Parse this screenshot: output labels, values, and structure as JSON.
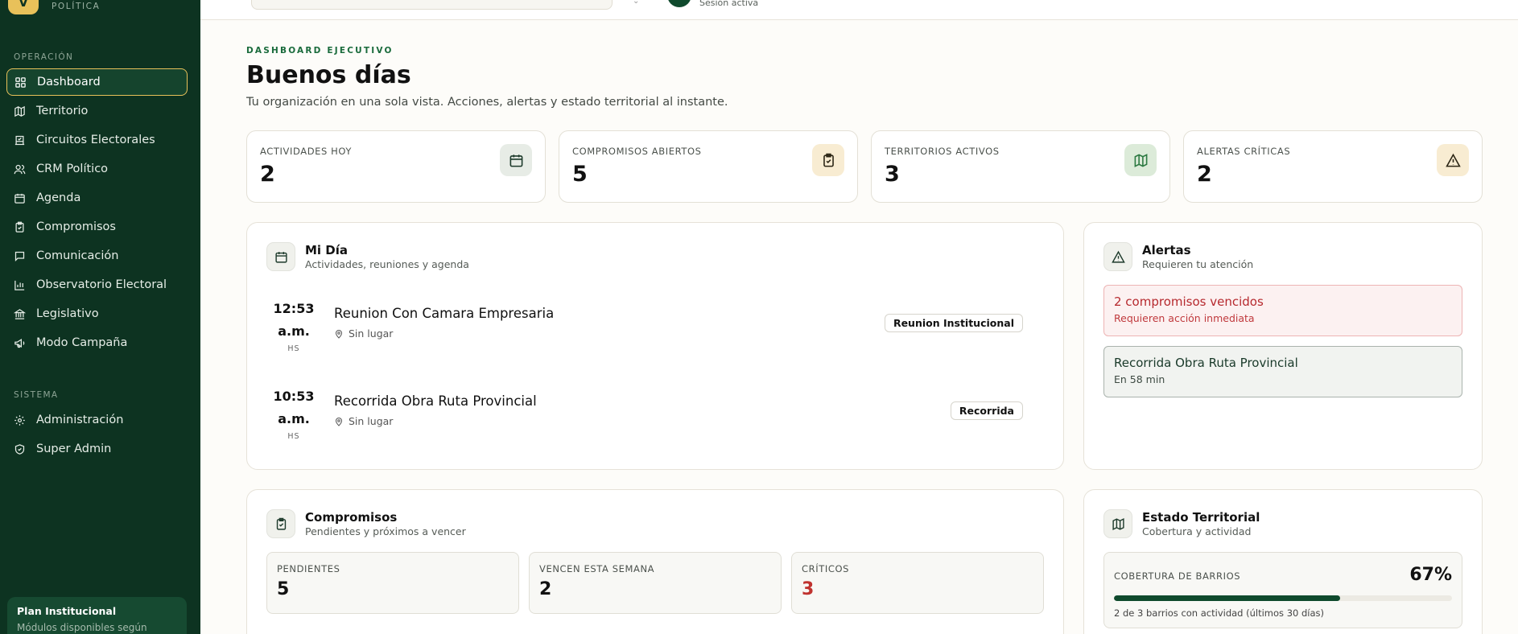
{
  "brand": {
    "logo_letter": "V",
    "subtitle": "POLÍTICA"
  },
  "sidebar": {
    "section_operation": "OPERACIÓN",
    "section_system": "SISTEMA",
    "operation_items": [
      {
        "label": "Dashboard",
        "icon": "grid-icon"
      },
      {
        "label": "Territorio",
        "icon": "map-icon"
      },
      {
        "label": "Circuitos Electorales",
        "icon": "ballot-icon"
      },
      {
        "label": "CRM Político",
        "icon": "users-icon"
      },
      {
        "label": "Agenda",
        "icon": "calendar-icon"
      },
      {
        "label": "Compromisos",
        "icon": "clipboard-check-icon"
      },
      {
        "label": "Comunicación",
        "icon": "message-icon"
      },
      {
        "label": "Observatorio Electoral",
        "icon": "bar-chart-icon"
      },
      {
        "label": "Legislativo",
        "icon": "landmark-icon"
      },
      {
        "label": "Modo Campaña",
        "icon": "megaphone-icon"
      }
    ],
    "system_items": [
      {
        "label": "Administración",
        "icon": "gear-icon"
      },
      {
        "label": "Super Admin",
        "icon": "shield-check-icon"
      }
    ],
    "plan": {
      "title": "Plan Institucional",
      "description": "Módulos disponibles según"
    }
  },
  "topbar": {
    "session_status": "Sesión activa"
  },
  "header": {
    "eyebrow": "DASHBOARD EJECUTIVO",
    "greeting": "Buenos días",
    "subtitle": "Tu organización en una sola vista. Acciones, alertas y estado territorial al instante."
  },
  "stats": [
    {
      "label": "ACTIVIDADES HOY",
      "value": "2",
      "icon": "calendar-icon",
      "icon_bg": "#e7ece6"
    },
    {
      "label": "COMPROMISOS ABIERTOS",
      "value": "5",
      "icon": "clipboard-check-icon",
      "icon_bg": "#f8ecd2"
    },
    {
      "label": "TERRITORIOS ACTIVOS",
      "value": "3",
      "icon": "map-icon",
      "icon_bg": "#dcebd9"
    },
    {
      "label": "ALERTAS CRÍTICAS",
      "value": "2",
      "icon": "alert-triangle-icon",
      "icon_bg": "#f8ecd2"
    }
  ],
  "mi_dia": {
    "title": "Mi Día",
    "subtitle": "Actividades, reuniones y agenda",
    "events": [
      {
        "time": "12:53 a.m.",
        "unit": "HS",
        "title": "Reunion Con Camara Empresaria",
        "location": "Sin lugar",
        "badge": "Reunion Institucional"
      },
      {
        "time": "10:53 a.m.",
        "unit": "HS",
        "title": "Recorrida Obra Ruta Provincial",
        "location": "Sin lugar",
        "badge": "Recorrida"
      }
    ]
  },
  "alerts": {
    "title": "Alertas",
    "subtitle": "Requieren tu atención",
    "items": [
      {
        "title": "2 compromisos vencidos",
        "description": "Requieren acción inmediata",
        "severity": "critical"
      },
      {
        "title": "Recorrida Obra Ruta Provincial",
        "description": "En 58 min",
        "severity": "info"
      }
    ]
  },
  "compromisos": {
    "title": "Compromisos",
    "subtitle": "Pendientes y próximos a vencer",
    "stats": [
      {
        "label": "PENDIENTES",
        "value": "5"
      },
      {
        "label": "VENCEN ESTA SEMANA",
        "value": "2"
      },
      {
        "label": "CRÍTICOS",
        "value": "3"
      }
    ]
  },
  "territorial": {
    "title": "Estado Territorial",
    "subtitle": "Cobertura y actividad",
    "coverage_label": "COBERTURA DE BARRIOS",
    "coverage_value": "67%",
    "coverage_fraction": 0.67,
    "coverage_description": "2 de 3 barrios con actividad (últimos 30 días)"
  },
  "colors": {
    "sidebar_bg": "#0d3321",
    "accent_gold": "#e8c15a",
    "brand_green": "#0f4a2d",
    "critical_red": "#c0332f"
  }
}
